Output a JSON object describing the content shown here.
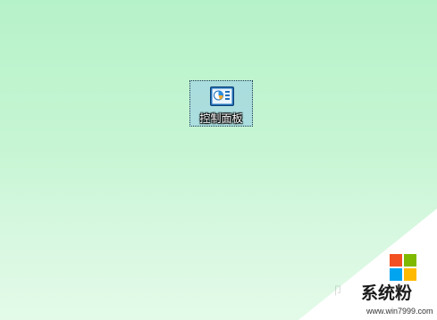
{
  "desktop": {
    "background_colors": [
      "#b6f2c9",
      "#e3fae9"
    ],
    "icons": [
      {
        "label": "控制面板",
        "icon": "control-panel-icon",
        "selected": true
      }
    ]
  },
  "watermark": {
    "brand_text": "系统粉",
    "url_text": "www.win7999.com",
    "logo": "windows-logo-icon",
    "logo_colors": [
      "#f25022",
      "#7fba00",
      "#00a4ef",
      "#ffb900"
    ]
  }
}
